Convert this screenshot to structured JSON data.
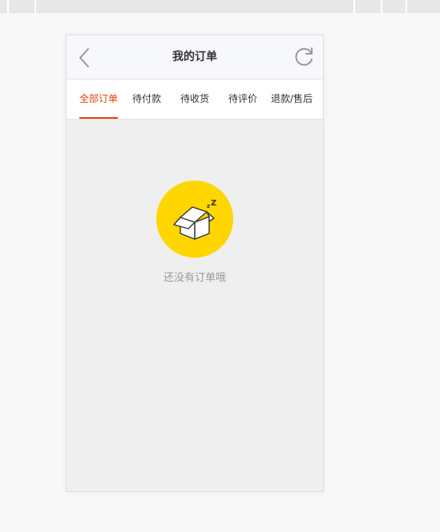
{
  "header": {
    "title": "我的订单",
    "back_icon": "chevron-left-icon",
    "refresh_icon": "refresh-icon"
  },
  "tabs": [
    {
      "label": "全部订单",
      "active": true
    },
    {
      "label": "待付款",
      "active": false
    },
    {
      "label": "待收货",
      "active": false
    },
    {
      "label": "待评价",
      "active": false
    },
    {
      "label": "退款/售后",
      "active": false
    }
  ],
  "empty_state": {
    "icon": "sleeping-box-icon",
    "message": "还没有订单哦"
  },
  "colors": {
    "accent": "#e6400d",
    "empty_icon_bg": "#ffd600",
    "page_bg": "#efefef"
  }
}
